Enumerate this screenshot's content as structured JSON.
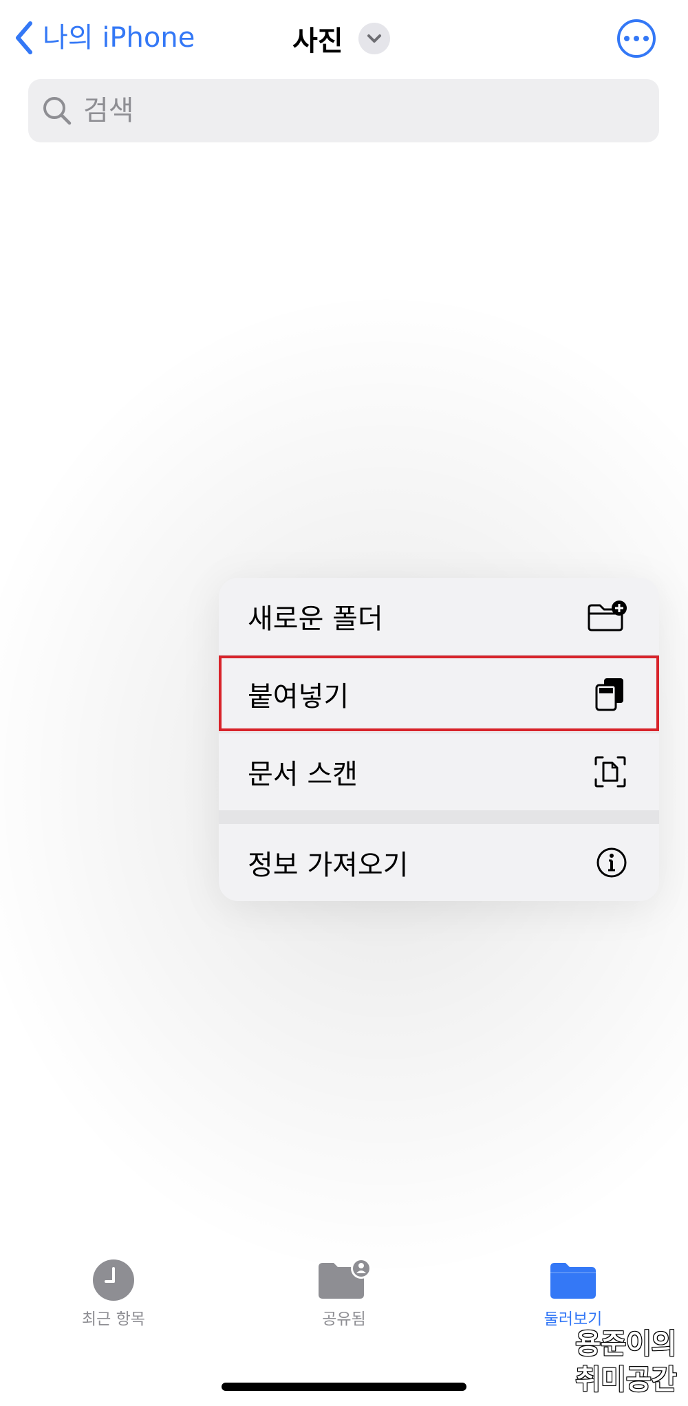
{
  "nav": {
    "back_label": "나의 iPhone",
    "title": "사진"
  },
  "search": {
    "placeholder": "검색"
  },
  "context_menu": {
    "items": [
      {
        "label": "새로운 폴더",
        "icon": "folder-plus-icon"
      },
      {
        "label": "붙여넣기",
        "icon": "paste-icon",
        "highlighted": true
      },
      {
        "label": "문서 스캔",
        "icon": "doc-scan-icon"
      },
      {
        "label": "정보 가져오기",
        "icon": "info-icon"
      }
    ]
  },
  "tabbar": {
    "tabs": [
      {
        "label": "최근 항목",
        "icon": "clock-icon",
        "active": false
      },
      {
        "label": "공유됨",
        "icon": "shared-folder-icon",
        "active": false
      },
      {
        "label": "둘러보기",
        "icon": "folder-icon",
        "active": true
      }
    ]
  },
  "watermark": {
    "line1": "용준이의",
    "line2": "취미공간"
  },
  "colors": {
    "accent": "#3478f6",
    "highlight_border": "#d8232a",
    "tab_inactive": "#8e8e93",
    "search_bg": "#eeeef0",
    "menu_bg": "#f2f2f4"
  }
}
